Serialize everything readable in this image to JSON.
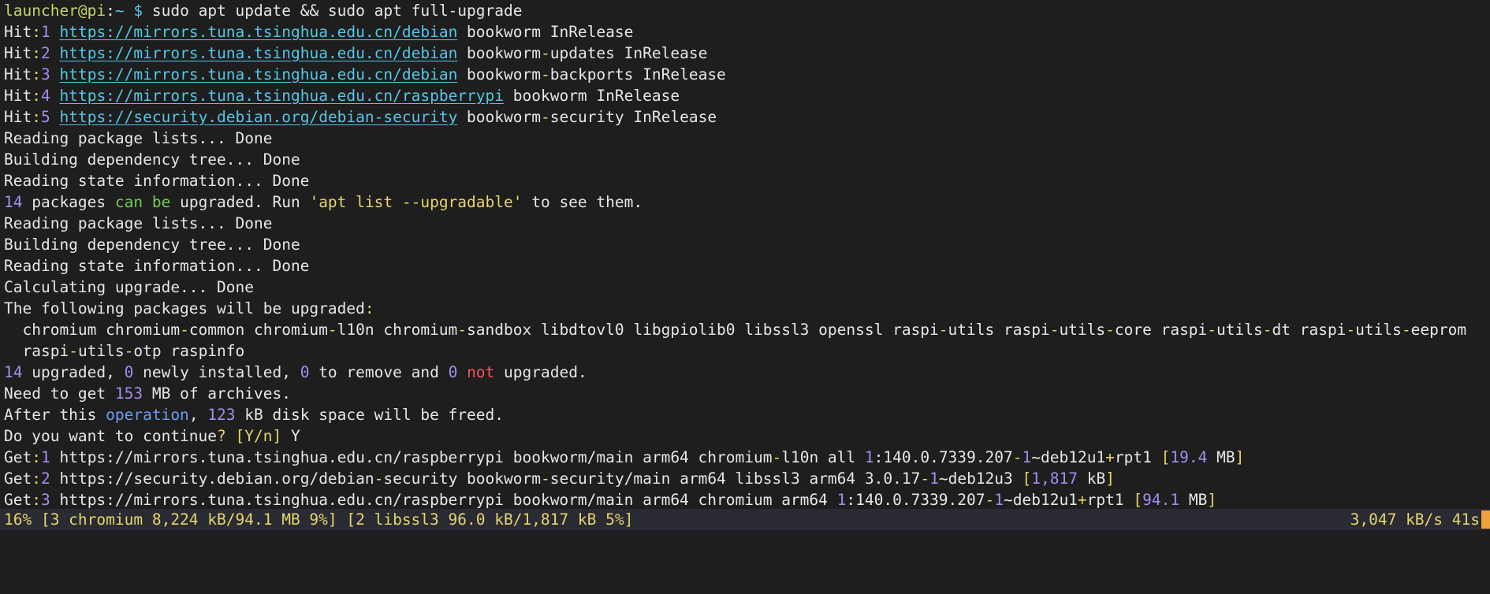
{
  "terminal": {
    "lines": [
      {
        "segments": [
          {
            "t": "launcher@pi",
            "c": "prompt"
          },
          {
            "t": ":",
            "c": "def"
          },
          {
            "t": "~",
            "c": "cyan"
          },
          {
            "t": " $ ",
            "c": "cyan"
          },
          {
            "t": "sudo apt update && sudo apt full-upgrade",
            "c": "def"
          }
        ]
      },
      {
        "segments": [
          {
            "t": "Hit",
            "c": "def"
          },
          {
            "t": ":",
            "c": "op"
          },
          {
            "t": "1",
            "c": "num"
          },
          {
            "t": " ",
            "c": "def"
          },
          {
            "t": "https://mirrors.tuna.tsinghua.edu.cn/debian",
            "c": "link"
          },
          {
            "t": " bookworm InRelease",
            "c": "def"
          }
        ]
      },
      {
        "segments": [
          {
            "t": "Hit",
            "c": "def"
          },
          {
            "t": ":",
            "c": "op"
          },
          {
            "t": "2",
            "c": "num"
          },
          {
            "t": " ",
            "c": "def"
          },
          {
            "t": "https://mirrors.tuna.tsinghua.edu.cn/debian",
            "c": "link"
          },
          {
            "t": " bookworm",
            "c": "def"
          },
          {
            "t": "-",
            "c": "op"
          },
          {
            "t": "updates InRelease",
            "c": "def"
          }
        ]
      },
      {
        "segments": [
          {
            "t": "Hit",
            "c": "def"
          },
          {
            "t": ":",
            "c": "op"
          },
          {
            "t": "3",
            "c": "num"
          },
          {
            "t": " ",
            "c": "def"
          },
          {
            "t": "https://mirrors.tuna.tsinghua.edu.cn/debian",
            "c": "link"
          },
          {
            "t": " bookworm",
            "c": "def"
          },
          {
            "t": "-",
            "c": "op"
          },
          {
            "t": "backports InRelease",
            "c": "def"
          }
        ]
      },
      {
        "segments": [
          {
            "t": "Hit",
            "c": "def"
          },
          {
            "t": ":",
            "c": "op"
          },
          {
            "t": "4",
            "c": "num"
          },
          {
            "t": " ",
            "c": "def"
          },
          {
            "t": "https://mirrors.tuna.tsinghua.edu.cn/raspberrypi",
            "c": "link"
          },
          {
            "t": " bookworm InRelease",
            "c": "def"
          }
        ]
      },
      {
        "segments": [
          {
            "t": "Hit",
            "c": "def"
          },
          {
            "t": ":",
            "c": "op"
          },
          {
            "t": "5",
            "c": "num"
          },
          {
            "t": " ",
            "c": "def"
          },
          {
            "t": "https://security.debian.org/debian-security",
            "c": "link"
          },
          {
            "t": " bookworm",
            "c": "def"
          },
          {
            "t": "-",
            "c": "op"
          },
          {
            "t": "security InRelease",
            "c": "def"
          }
        ]
      },
      {
        "segments": [
          {
            "t": "Reading package lists... Done",
            "c": "def"
          }
        ]
      },
      {
        "segments": [
          {
            "t": "Building dependency tree... Done",
            "c": "def"
          }
        ]
      },
      {
        "segments": [
          {
            "t": "Reading state information... Done",
            "c": "def"
          }
        ]
      },
      {
        "segments": [
          {
            "t": "14",
            "c": "num"
          },
          {
            "t": " packages ",
            "c": "def"
          },
          {
            "t": "can be",
            "c": "green"
          },
          {
            "t": " upgraded. Run ",
            "c": "def"
          },
          {
            "t": "'apt list --upgradable'",
            "c": "yellow"
          },
          {
            "t": " to see them.",
            "c": "def"
          }
        ]
      },
      {
        "segments": [
          {
            "t": "Reading package lists... Done",
            "c": "def"
          }
        ]
      },
      {
        "segments": [
          {
            "t": "Building dependency tree... Done",
            "c": "def"
          }
        ]
      },
      {
        "segments": [
          {
            "t": "Reading state information... Done",
            "c": "def"
          }
        ]
      },
      {
        "segments": [
          {
            "t": "Calculating upgrade... Done",
            "c": "def"
          }
        ]
      },
      {
        "segments": [
          {
            "t": "The following packages will be upgraded",
            "c": "def"
          },
          {
            "t": ":",
            "c": "op"
          }
        ]
      },
      {
        "segments": [
          {
            "t": "  chromium chromium",
            "c": "def"
          },
          {
            "t": "-",
            "c": "op"
          },
          {
            "t": "common chromium",
            "c": "def"
          },
          {
            "t": "-",
            "c": "op"
          },
          {
            "t": "l10n chromium",
            "c": "def"
          },
          {
            "t": "-",
            "c": "op"
          },
          {
            "t": "sandbox libdtovl0 libgpiolib0 libssl3 openssl raspi",
            "c": "def"
          },
          {
            "t": "-",
            "c": "op"
          },
          {
            "t": "utils raspi",
            "c": "def"
          },
          {
            "t": "-",
            "c": "op"
          },
          {
            "t": "utils",
            "c": "def"
          },
          {
            "t": "-",
            "c": "op"
          },
          {
            "t": "core raspi",
            "c": "def"
          },
          {
            "t": "-",
            "c": "op"
          },
          {
            "t": "utils",
            "c": "def"
          },
          {
            "t": "-",
            "c": "op"
          },
          {
            "t": "dt raspi",
            "c": "def"
          },
          {
            "t": "-",
            "c": "op"
          },
          {
            "t": "utils",
            "c": "def"
          },
          {
            "t": "-",
            "c": "op"
          },
          {
            "t": "eeprom",
            "c": "def"
          }
        ]
      },
      {
        "segments": [
          {
            "t": "  raspi",
            "c": "def"
          },
          {
            "t": "-",
            "c": "op"
          },
          {
            "t": "utils",
            "c": "def"
          },
          {
            "t": "-",
            "c": "op"
          },
          {
            "t": "otp raspinfo",
            "c": "def"
          }
        ]
      },
      {
        "segments": [
          {
            "t": "14",
            "c": "num"
          },
          {
            "t": " upgraded, ",
            "c": "def"
          },
          {
            "t": "0",
            "c": "num"
          },
          {
            "t": " newly installed, ",
            "c": "def"
          },
          {
            "t": "0",
            "c": "num"
          },
          {
            "t": " to remove and ",
            "c": "def"
          },
          {
            "t": "0",
            "c": "num"
          },
          {
            "t": " ",
            "c": "def"
          },
          {
            "t": "not",
            "c": "red"
          },
          {
            "t": " upgraded.",
            "c": "def"
          }
        ]
      },
      {
        "segments": [
          {
            "t": "Need to get ",
            "c": "def"
          },
          {
            "t": "153",
            "c": "num"
          },
          {
            "t": " MB of archives.",
            "c": "def"
          }
        ]
      },
      {
        "segments": [
          {
            "t": "After this ",
            "c": "def"
          },
          {
            "t": "operation",
            "c": "blue"
          },
          {
            "t": ", ",
            "c": "def"
          },
          {
            "t": "123",
            "c": "num"
          },
          {
            "t": " kB disk space will be freed.",
            "c": "def"
          }
        ]
      },
      {
        "segments": [
          {
            "t": "Do you want to continue",
            "c": "def"
          },
          {
            "t": "? ",
            "c": "op"
          },
          {
            "t": "[Y/n]",
            "c": "op"
          },
          {
            "t": " Y",
            "c": "def"
          }
        ]
      },
      {
        "segments": [
          {
            "t": "Get",
            "c": "def"
          },
          {
            "t": ":",
            "c": "op"
          },
          {
            "t": "1",
            "c": "num"
          },
          {
            "t": " https://mirrors.tuna.tsinghua.edu.cn/raspberrypi bookworm/main arm64 chromium",
            "c": "def"
          },
          {
            "t": "-",
            "c": "op"
          },
          {
            "t": "l10n all ",
            "c": "def"
          },
          {
            "t": "1",
            "c": "num"
          },
          {
            "t": ":140.0.7339.207",
            "c": "def"
          },
          {
            "t": "-",
            "c": "op"
          },
          {
            "t": "1",
            "c": "num"
          },
          {
            "t": "~deb12u1",
            "c": "def"
          },
          {
            "t": "+",
            "c": "op"
          },
          {
            "t": "rpt1 ",
            "c": "def"
          },
          {
            "t": "[",
            "c": "op"
          },
          {
            "t": "19.4",
            "c": "num"
          },
          {
            "t": " MB",
            "c": "def"
          },
          {
            "t": "]",
            "c": "op"
          }
        ]
      },
      {
        "segments": [
          {
            "t": "Get",
            "c": "def"
          },
          {
            "t": ":",
            "c": "op"
          },
          {
            "t": "2",
            "c": "num"
          },
          {
            "t": " https://security.debian.org/debian",
            "c": "def"
          },
          {
            "t": "-",
            "c": "op"
          },
          {
            "t": "security bookworm",
            "c": "def"
          },
          {
            "t": "-",
            "c": "op"
          },
          {
            "t": "security/main arm64 libssl3 arm64 3.0.17",
            "c": "def"
          },
          {
            "t": "-",
            "c": "op"
          },
          {
            "t": "1",
            "c": "num"
          },
          {
            "t": "~deb12u3 ",
            "c": "def"
          },
          {
            "t": "[",
            "c": "op"
          },
          {
            "t": "1,817",
            "c": "num"
          },
          {
            "t": " kB",
            "c": "def"
          },
          {
            "t": "]",
            "c": "op"
          }
        ]
      },
      {
        "segments": [
          {
            "t": "Get",
            "c": "def"
          },
          {
            "t": ":",
            "c": "op"
          },
          {
            "t": "3",
            "c": "num"
          },
          {
            "t": " https://mirrors.tuna.tsinghua.edu.cn/raspberrypi bookworm/main arm64 chromium arm64 ",
            "c": "def"
          },
          {
            "t": "1",
            "c": "num"
          },
          {
            "t": ":140.0.7339.207",
            "c": "def"
          },
          {
            "t": "-",
            "c": "op"
          },
          {
            "t": "1",
            "c": "num"
          },
          {
            "t": "~deb12u1",
            "c": "def"
          },
          {
            "t": "+",
            "c": "op"
          },
          {
            "t": "rpt1 ",
            "c": "def"
          },
          {
            "t": "[",
            "c": "op"
          },
          {
            "t": "94.1",
            "c": "num"
          },
          {
            "t": " MB",
            "c": "def"
          },
          {
            "t": "]",
            "c": "op"
          }
        ]
      }
    ]
  },
  "status": {
    "progress_text": "16% [3 chromium 8,224 kB/94.1 MB 9%] [2 libssl3 96.0 kB/1,817 kB 5%]",
    "speed_text": "3,047 kB/s 41s"
  },
  "colors": {
    "background": "#1e1e1e",
    "statusbar": "#2a2a33",
    "cursor": "#f0a23a"
  }
}
